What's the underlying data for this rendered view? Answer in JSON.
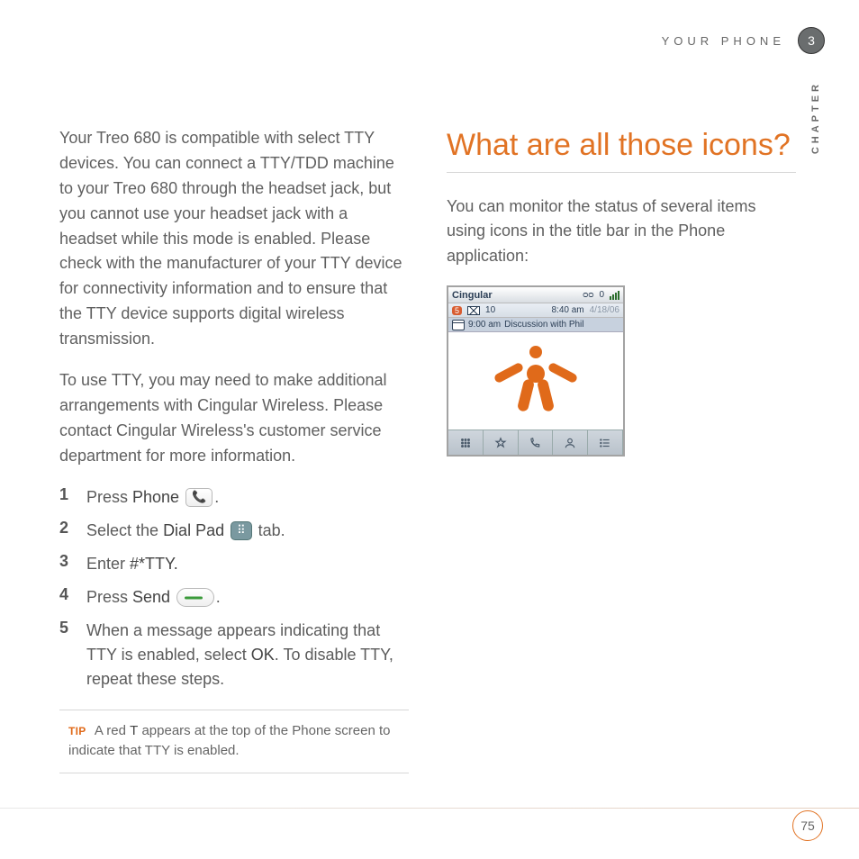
{
  "header": {
    "section": "YOUR PHONE",
    "chapter_num": "3",
    "chapter_word": "CHAPTER"
  },
  "left": {
    "p1": "Your Treo 680 is compatible with select TTY devices. You can connect a TTY/TDD machine to your Treo 680 through the headset jack, but you cannot use your headset jack with a headset while this mode is enabled. Please check with the manufacturer of your TTY device for connectivity information and to ensure that the TTY device supports digital wireless transmission.",
    "p2": "To use TTY, you may need to make additional arrangements with Cingular Wireless. Please contact Cingular Wireless's customer service department for more information.",
    "steps": {
      "s1": {
        "num": "1",
        "pre": "Press ",
        "b": "Phone",
        "post": " "
      },
      "s2": {
        "num": "2",
        "pre": "Select the ",
        "b": "Dial Pad",
        "post": " ",
        "tail": " tab."
      },
      "s3": {
        "num": "3",
        "pre": "Enter ",
        "b": "#*TTY."
      },
      "s4": {
        "num": "4",
        "pre": "Press ",
        "b": "Send",
        "post": " "
      },
      "s5": {
        "num": "5",
        "pre": "When a message appears indicating that TTY is enabled, select ",
        "b": "OK",
        "post": ". To disable TTY, repeat these steps."
      }
    },
    "tip": {
      "label": "TIP",
      "pre": "A red ",
      "b": "T",
      "post": " appears at the top of the Phone screen to indicate that TTY is enabled."
    }
  },
  "right": {
    "heading": "What are all those icons?",
    "p1": "You can monitor the status of several items using icons in the title bar in the Phone application:",
    "phone": {
      "brand": "Cingular",
      "vm": "ᴑᴑ",
      "batt": "0",
      "name": "5",
      "mailcount": "10",
      "time": "8:40 am",
      "date": "4/18/06",
      "cal_time": "9:00 am",
      "cal_text": "Discussion with Phil"
    }
  },
  "footer": {
    "page": "75"
  }
}
